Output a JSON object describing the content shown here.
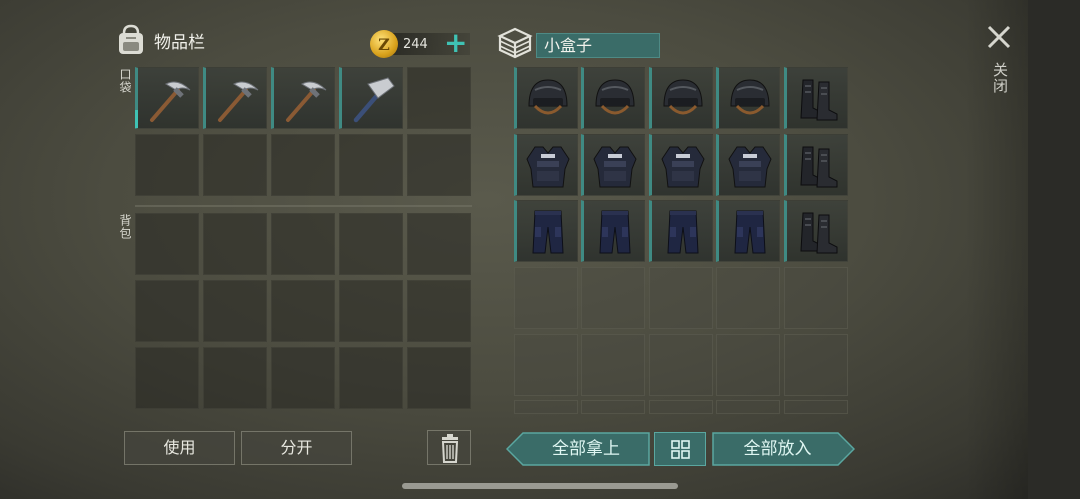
{
  "inventory": {
    "title": "物品栏",
    "pocket_label": "口袋",
    "backpack_label": "背包",
    "coins": "244",
    "coin_symbol": "Z",
    "add_coins_symbol": "+",
    "pocket_items": [
      {
        "name": "pickaxe"
      },
      {
        "name": "pickaxe"
      },
      {
        "name": "pickaxe"
      },
      {
        "name": "hammer-pickaxe"
      }
    ]
  },
  "container": {
    "name": "小盒子",
    "rows": [
      [
        "police-helmet",
        "police-helmet",
        "police-helmet",
        "police-helmet",
        "combat-boots"
      ],
      [
        "police-vest",
        "police-vest",
        "police-vest",
        "police-vest",
        "combat-boots"
      ],
      [
        "police-pants",
        "police-pants",
        "police-pants",
        "police-pants",
        "combat-boots"
      ]
    ]
  },
  "actions": {
    "use_label": "使用",
    "split_label": "分开",
    "take_all_label": "全部拿上",
    "put_all_label": "全部放入",
    "close_label": "关闭"
  },
  "colors": {
    "accent_teal": "#3fc2b4",
    "field_teal": "#3a6c68",
    "coin_gold": "#d9a21c"
  }
}
